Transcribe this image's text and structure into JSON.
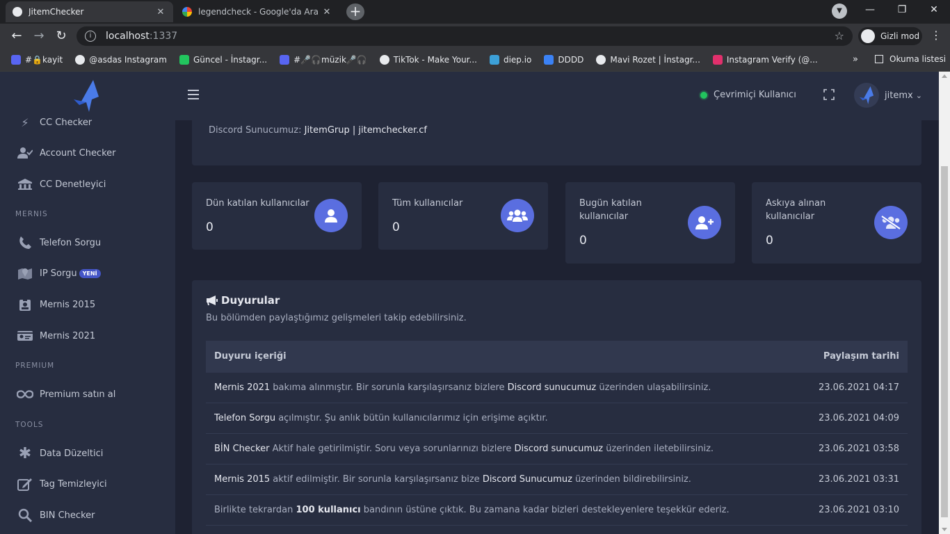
{
  "browser": {
    "tabs": [
      {
        "title": "JitemChecker",
        "active": true
      },
      {
        "title": "legendcheck - Google'da Ara",
        "active": false
      }
    ],
    "url_host": "localhost",
    "url_port": ":1337",
    "incognito_label": "Gizli mod",
    "bookmarks": [
      {
        "label": "#🔒kayit",
        "color": "#5865f2"
      },
      {
        "label": "@asdas Instagram",
        "color": "#e8eaed"
      },
      {
        "label": "Güncel - İnstagr...",
        "color": "#22c55e"
      },
      {
        "label": "#🎤🎧müzik🎤🎧",
        "color": "#5865f2"
      },
      {
        "label": "TikTok - Make Your...",
        "color": "#e8eaed"
      },
      {
        "label": "diep.io",
        "color": "#3ca0d8"
      },
      {
        "label": "DDDD",
        "color": "#3b82f6"
      },
      {
        "label": "Mavi Rozet | İnstagr...",
        "color": "#e8eaed"
      },
      {
        "label": "Instagram Verify (@...",
        "color": "#e1306c"
      }
    ],
    "bookmarks_more": "»",
    "reading_list": "Okuma listesi"
  },
  "sidebar": {
    "items_top": [
      {
        "label": "CC Checker",
        "icon": "bolt-icon"
      },
      {
        "label": "Account Checker",
        "icon": "user-check-icon"
      },
      {
        "label": "CC Denetleyici",
        "icon": "building-icon"
      }
    ],
    "section_mernis": "MERNIS",
    "items_mernis": [
      {
        "label": "Telefon Sorgu",
        "icon": "phone-icon"
      },
      {
        "label": "IP Sorgu",
        "icon": "map-marker-icon",
        "badge": "YENİ"
      },
      {
        "label": "Mernis 2015",
        "icon": "id-badge-icon"
      },
      {
        "label": "Mernis 2021",
        "icon": "id-card-icon"
      }
    ],
    "section_premium": "PREMIUM",
    "items_premium": [
      {
        "label": "Premium satın al",
        "icon": "infinity-icon"
      }
    ],
    "section_tools": "TOOLS",
    "items_tools": [
      {
        "label": "Data Düzeltici",
        "icon": "asterisk-icon"
      },
      {
        "label": "Tag Temizleyici",
        "icon": "edit-icon"
      },
      {
        "label": "BIN Checker",
        "icon": "search-icon"
      }
    ]
  },
  "topbar": {
    "online_label": "Çevrimiçi Kullanıcı",
    "username": "jitemx",
    "chevron": "⌄"
  },
  "discord": {
    "prefix": "Discord Sunucumuz:",
    "value": "JitemGrup | jitemchecker.cf"
  },
  "stats": [
    {
      "label": "Dün katılan kullanıcılar",
      "value": "0",
      "icon": "user-icon"
    },
    {
      "label": "Tüm kullanıcılar",
      "value": "0",
      "icon": "users-icon"
    },
    {
      "label": "Bugün katılan kullanıcılar",
      "value": "0",
      "icon": "user-plus-icon"
    },
    {
      "label": "Askıya alınan kullanıcılar",
      "value": "0",
      "icon": "users-slash-icon"
    }
  ],
  "announcements": {
    "title": "Duyurular",
    "subtitle": "Bu bölümden paylaştığımız gelişmeleri takip edebilirsiniz.",
    "col_content": "Duyuru içeriği",
    "col_date": "Paylaşım tarihi",
    "rows": [
      {
        "parts": [
          {
            "t": "Mernis 2021",
            "s": "hl"
          },
          {
            "t": " bakıma alınmıştır. Bir sorunla karşılaşırsanız bizlere ",
            "s": ""
          },
          {
            "t": "Discord sunucumuz",
            "s": "hl"
          },
          {
            "t": " üzerinden ulaşabilirsiniz.",
            "s": ""
          }
        ],
        "date": "23.06.2021 04:17"
      },
      {
        "parts": [
          {
            "t": "Telefon Sorgu",
            "s": "hl"
          },
          {
            "t": " açılmıştır. Şu anlık bütün kullanıcılarımız için erişime açıktır.",
            "s": ""
          }
        ],
        "date": "23.06.2021 04:09"
      },
      {
        "parts": [
          {
            "t": "BİN Checker",
            "s": "hl"
          },
          {
            "t": " Aktif hale getirilmiştir. Soru veya sorunlarınızı bizlere ",
            "s": ""
          },
          {
            "t": "Discord sunucumuz",
            "s": "hl"
          },
          {
            "t": " üzerinden iletebilirsiniz.",
            "s": ""
          }
        ],
        "date": "23.06.2021 03:58"
      },
      {
        "parts": [
          {
            "t": "Mernis 2015",
            "s": "hl"
          },
          {
            "t": " aktif edilmiştir. Bir sorunla karşılaşırsanız bize ",
            "s": ""
          },
          {
            "t": "Discord Sunucumuz",
            "s": "hl"
          },
          {
            "t": " üzerinden bildirebilirsiniz.",
            "s": ""
          }
        ],
        "date": "23.06.2021 03:31"
      },
      {
        "parts": [
          {
            "t": "Birlikte tekrardan ",
            "s": ""
          },
          {
            "t": "100 kullanıcı",
            "s": "bd"
          },
          {
            "t": " bandının üstüne çıktık. Bu zamana kadar bizleri destekleyenlere teşekkür ederiz.",
            "s": ""
          }
        ],
        "date": "23.06.2021 03:10"
      }
    ]
  },
  "colors": {
    "accent": "#5a6ee0",
    "online": "#22c55e",
    "sidebar_bg": "#272d40",
    "page_bg": "#1e2232"
  }
}
